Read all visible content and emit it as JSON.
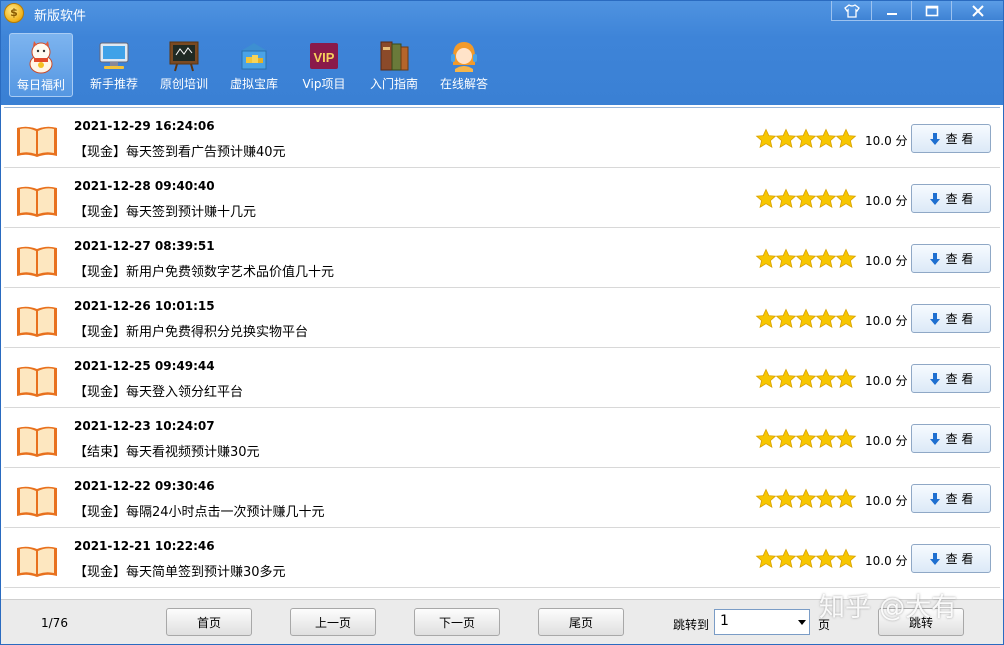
{
  "app": {
    "title": "新版软件"
  },
  "window_buttons": {
    "skin": "shirt-icon",
    "minimize": "minimize-icon",
    "maximize": "maximize-icon",
    "close": "close-icon"
  },
  "toolbar": {
    "items": [
      {
        "label": "每日福利",
        "icon": "lucky-cat-icon",
        "active": true
      },
      {
        "label": "新手推荐",
        "icon": "monitor-icon",
        "active": false
      },
      {
        "label": "原创培训",
        "icon": "blackboard-icon",
        "active": false
      },
      {
        "label": "虚拟宝库",
        "icon": "treasure-box-icon",
        "active": false
      },
      {
        "label": "Vip项目",
        "icon": "vip-icon",
        "active": false
      },
      {
        "label": "入门指南",
        "icon": "books-icon",
        "active": false
      },
      {
        "label": "在线解答",
        "icon": "headset-girl-icon",
        "active": false
      }
    ]
  },
  "list": {
    "rows": [
      {
        "date": "2021-12-29 16:24:06",
        "title": "【现金】每天签到看广告预计赚40元",
        "score": "10.0 分",
        "rating": 5,
        "view_label": "查 看"
      },
      {
        "date": "2021-12-28 09:40:40",
        "title": "【现金】每天签到预计赚十几元",
        "score": "10.0 分",
        "rating": 5,
        "view_label": "查 看"
      },
      {
        "date": "2021-12-27 08:39:51",
        "title": "【现金】新用户免费领数字艺术品价值几十元",
        "score": "10.0 分",
        "rating": 5,
        "view_label": "查 看"
      },
      {
        "date": "2021-12-26 10:01:15",
        "title": "【现金】新用户免费得积分兑换实物平台",
        "score": "10.0 分",
        "rating": 5,
        "view_label": "查 看"
      },
      {
        "date": "2021-12-25 09:49:44",
        "title": "【现金】每天登入领分红平台",
        "score": "10.0 分",
        "rating": 5,
        "view_label": "查 看"
      },
      {
        "date": "2021-12-23 10:24:07",
        "title": "【结束】每天看视频预计赚30元",
        "score": "10.0 分",
        "rating": 5,
        "view_label": "查 看"
      },
      {
        "date": "2021-12-22 09:30:46",
        "title": "【现金】每隔24小时点击一次预计赚几十元",
        "score": "10.0 分",
        "rating": 5,
        "view_label": "查 看"
      },
      {
        "date": "2021-12-21 10:22:46",
        "title": "【现金】每天简单签到预计赚30多元",
        "score": "10.0 分",
        "rating": 5,
        "view_label": "查 看"
      }
    ]
  },
  "pager": {
    "info": "1/76",
    "first": "首页",
    "prev": "上一页",
    "next": "下一页",
    "last": "尾页",
    "jump_label": "跳转到",
    "jump_value": "1",
    "page_label": "页",
    "go": "跳转"
  },
  "watermark": "知乎 @大有",
  "colors": {
    "title_bar": "#3e84d8",
    "star": "#f7c600",
    "book": "#e8711e"
  }
}
